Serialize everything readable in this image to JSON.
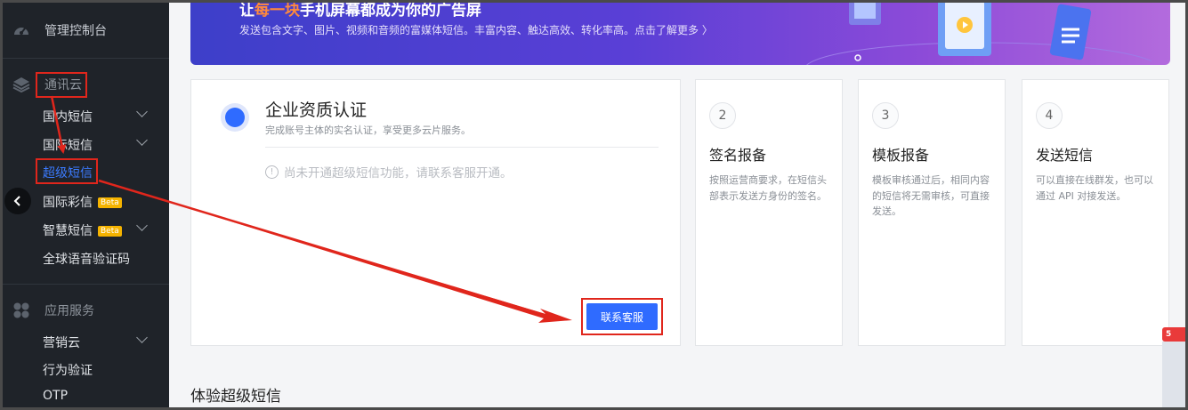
{
  "sidebar": {
    "console": "管理控制台",
    "group_comm": "通讯云",
    "items_comm": [
      {
        "label": "国内短信",
        "expandable": true
      },
      {
        "label": "国际短信",
        "expandable": true
      },
      {
        "label": "超级短信",
        "active": true
      },
      {
        "label": "国际彩信",
        "badge": "Beta"
      },
      {
        "label": "智慧短信",
        "badge": "Beta",
        "expandable": true
      },
      {
        "label": "全球语音验证码"
      }
    ],
    "group_app": "应用服务",
    "items_app": [
      {
        "label": "营销云",
        "expandable": true
      },
      {
        "label": "行为验证"
      },
      {
        "label": "OTP"
      }
    ]
  },
  "banner": {
    "title_pre": "让",
    "title_highlight": "每一块",
    "title_post": "手机屏幕都成为你的广告屏",
    "subtitle": "发送包含文字、图片、视频和音频的富媒体短信。丰富内容、触达高效、转化率高。点击了解更多 〉"
  },
  "step1": {
    "title": "企业资质认证",
    "subtitle": "完成账号主体的实名认证，享受更多云片服务。",
    "notice": "尚未开通超级短信功能，请联系客服开通。",
    "button": "联系客服"
  },
  "steps": [
    {
      "num": "2",
      "title": "签名报备",
      "desc": "按照运营商要求，在短信头部表示发送方身份的签名。"
    },
    {
      "num": "3",
      "title": "模板报备",
      "desc": "模板审核通过后，相同内容的短信将无需审核，可直接发送。"
    },
    {
      "num": "4",
      "title": "发送短信",
      "desc": "可以直接在线群发，也可以通过 API 对接发送。"
    }
  ],
  "section_title": "体验超级短信",
  "side_badge": "5",
  "colors": {
    "accent": "#2f6bff",
    "annotation": "#e0261c",
    "sidebar_bg": "#1f2329"
  }
}
